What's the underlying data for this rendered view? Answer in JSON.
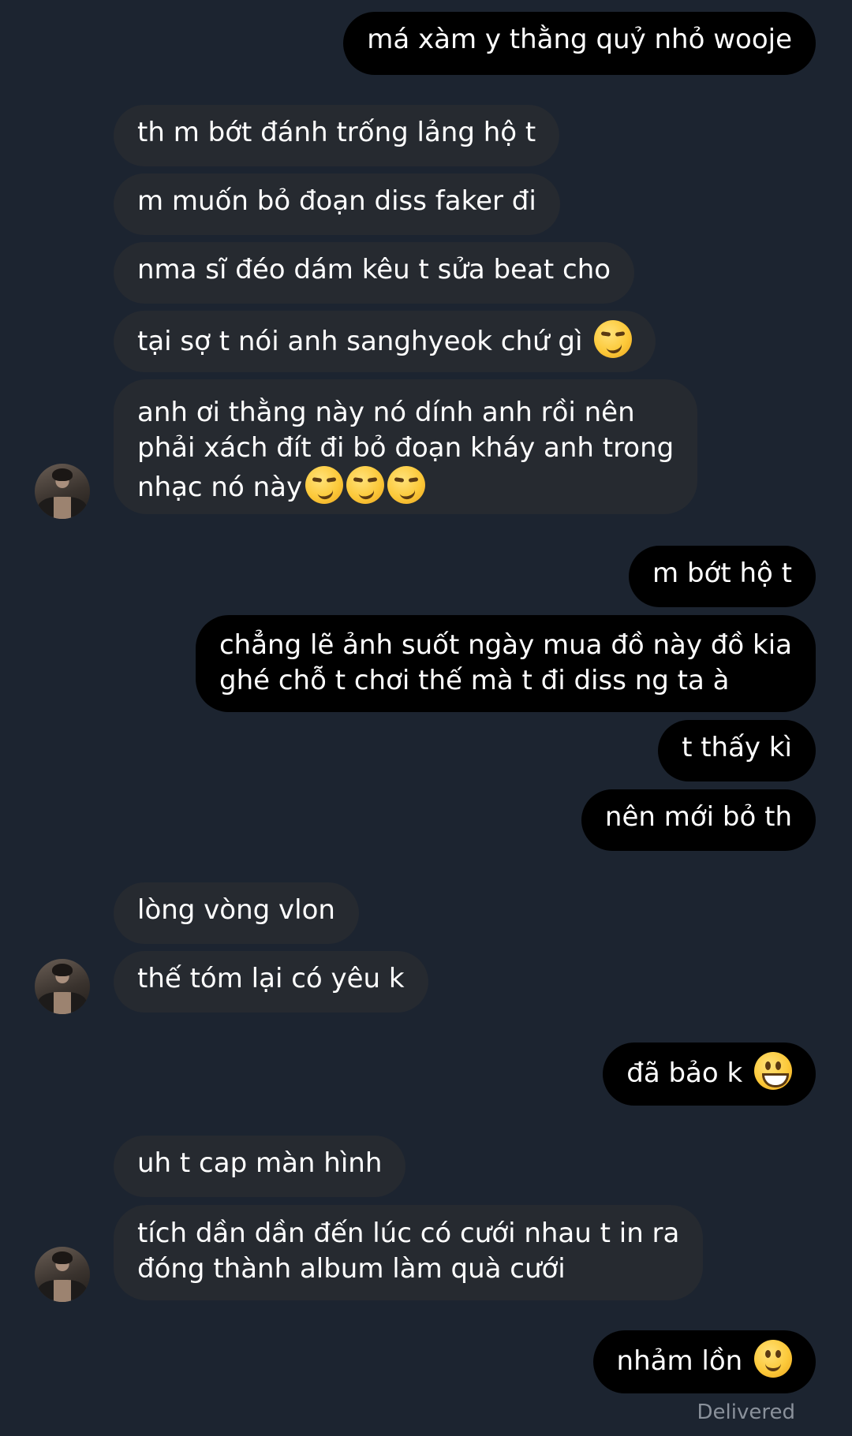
{
  "messages": [
    {
      "text": "má xàm y thằng quỷ nhỏ wooje"
    },
    {
      "text": "th m bớt đánh trống lảng hộ t"
    },
    {
      "text": "m muốn bỏ đoạn diss faker đi"
    },
    {
      "text": "nma sĩ đéo dám kêu t sửa beat cho"
    },
    {
      "text": "tại sợ t nói anh sanghyeok chứ gì",
      "emoji": [
        "smirking-face"
      ]
    },
    {
      "line1": "anh ơi thằng này nó dính anh rồi nên",
      "line2": "phải xách đít đi bỏ đoạn kháy anh trong",
      "line3": "nhạc nó này",
      "emoji": [
        "smirking-face",
        "smirking-face",
        "smirking-face"
      ]
    },
    {
      "text": "m bớt hộ t"
    },
    {
      "line1": "chẳng lẽ ảnh suốt ngày mua đồ này đồ kia",
      "line2": "ghé chỗ t chơi thế mà t đi diss ng ta à"
    },
    {
      "text": "t thấy kì"
    },
    {
      "text": "nên mới bỏ th"
    },
    {
      "text": "lòng vòng vlon"
    },
    {
      "text": "thế tóm lại có yêu k"
    },
    {
      "text": "đã bảo k",
      "emoji": [
        "grinning-face"
      ]
    },
    {
      "text": "uh t cap màn hình"
    },
    {
      "line1": "tích dần dần đến lúc có cưới nhau t in ra",
      "line2": "đóng thành album làm quà cưới"
    },
    {
      "text": "nhảm lồn",
      "emoji": [
        "slightly-smiling-face"
      ]
    }
  ],
  "status": {
    "delivered": "Delivered"
  },
  "colors": {
    "background": "#1c2430",
    "incoming_bubble": "#262a30",
    "outgoing_bubble": "#000000",
    "text": "#ffffff",
    "status_text": "#8a919b"
  }
}
